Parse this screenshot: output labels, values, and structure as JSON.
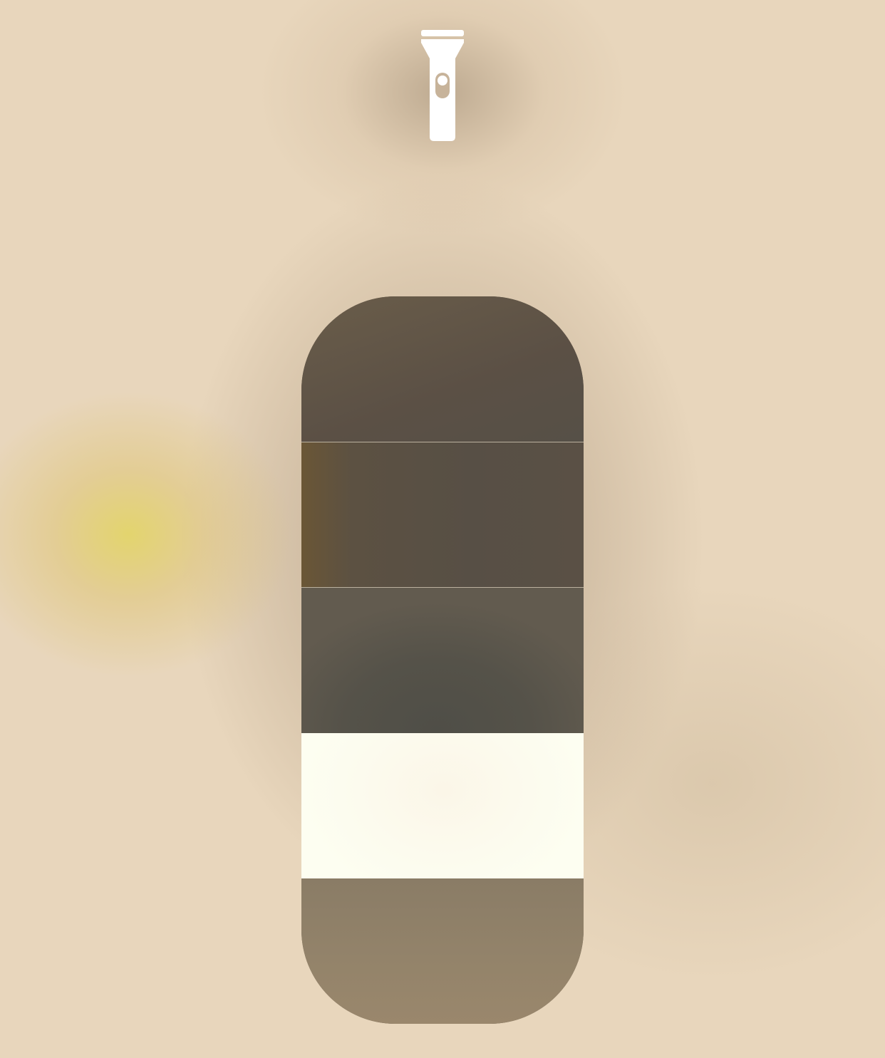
{
  "screen": {
    "control": "flashlight",
    "background_color": "#e8d6bc",
    "accent_glow_color": "#e2d460"
  },
  "torch_icon": {
    "icon": "flashlight-icon",
    "color": "#ffffff"
  },
  "brightness_slider": {
    "levels": 5,
    "current_level": 2,
    "lit_color": "#fdfef1",
    "unlit_color": "#5a5145"
  }
}
